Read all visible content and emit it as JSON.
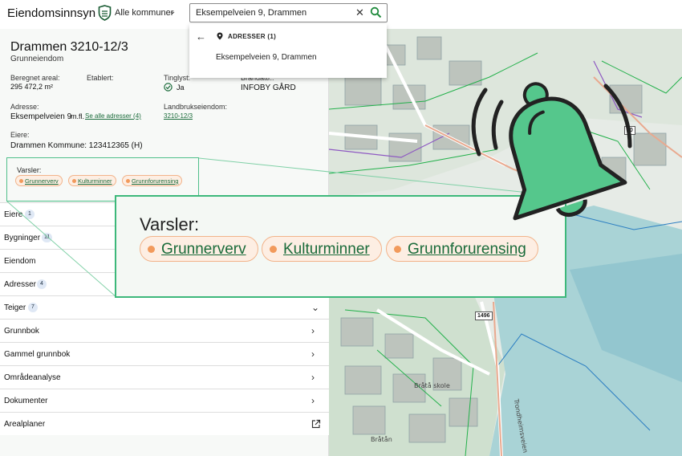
{
  "header": {
    "app_title": "Eiendomsinnsyn",
    "kommune_selector": "Alle kommuner",
    "search_value": "Eksempelveien 9, Drammen"
  },
  "dropdown": {
    "section_label": "ADRESSER (1)",
    "result": "Eksempelveien 9, Drammen"
  },
  "property": {
    "title": "Drammen 3210-12/3",
    "subtitle": "Grunneiendom",
    "area_label": "Beregnet areal:",
    "area_value": "295 472,2 m²",
    "established_label": "Etablert:",
    "tinglyst_label": "Tinglyst:",
    "tinglyst_value": "Ja",
    "brand_label": "Brandattr.:",
    "brand_value": "INFOBY GÅRD",
    "address_label": "Adresse:",
    "address_value": "Eksempelveien 9",
    "address_more": "m.fl.",
    "address_link": "Se alle adresser (4)",
    "landbruk_label": "Landbrukseiendom:",
    "landbruk_link": "3210-12/3",
    "owners_label": "Eiere:",
    "owners_value": "Drammen Kommune: 123412365 (H)"
  },
  "varsler": {
    "label": "Varsler:",
    "chips": [
      "Grunnerverv",
      "Kulturminner",
      "Grunnforurensing"
    ]
  },
  "sections": [
    {
      "label": "Eiere",
      "badge": "1",
      "arrow": "chevron-down"
    },
    {
      "label": "Bygninger",
      "badge": "11",
      "arrow": "chevron-down"
    },
    {
      "label": "Eiendom",
      "badge": "",
      "arrow": "chevron-down"
    },
    {
      "label": "Adresser",
      "badge": "4",
      "arrow": "chevron-down"
    },
    {
      "label": "Teiger",
      "badge": "7",
      "arrow": "chevron-down"
    },
    {
      "label": "Grunnbok",
      "badge": "",
      "arrow": "chevron-right"
    },
    {
      "label": "Gammel grunnbok",
      "badge": "",
      "arrow": "chevron-right"
    },
    {
      "label": "Områdeanalyse",
      "badge": "",
      "arrow": "chevron-right"
    },
    {
      "label": "Dokumenter",
      "badge": "",
      "arrow": "chevron-right"
    },
    {
      "label": "Arealplaner",
      "badge": "",
      "arrow": "external-link"
    }
  ],
  "map": {
    "labels": [
      "Bråtå skole",
      "Bråtån",
      "Trondheimsveien",
      "1496",
      "20"
    ]
  },
  "colors": {
    "accent_green": "#1a6b3a",
    "chip_fill": "#fdeee3",
    "chip_dot": "#f29a5c",
    "bell": "#55c78c"
  },
  "icons": [
    "shield-icon",
    "chevron-down-icon",
    "close-icon",
    "search-icon",
    "arrow-left-icon",
    "location-pin-icon",
    "check-circle-icon",
    "chevron-right-icon",
    "external-link-icon",
    "bell-icon"
  ]
}
